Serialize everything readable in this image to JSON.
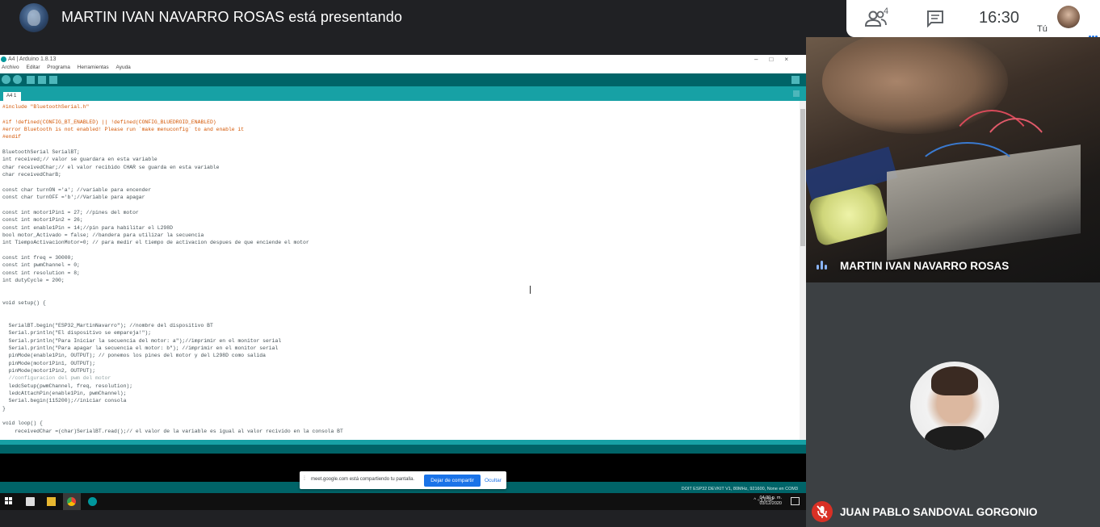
{
  "meet": {
    "presenting_text": "MARTIN IVAN NAVARRO ROSAS está presentando",
    "people_count": "4",
    "clock": "16:30",
    "self_label": "Tú",
    "participants": [
      {
        "name": "MARTIN IVAN NAVARRO ROSAS",
        "audio": "speaking"
      },
      {
        "name": "JUAN PABLO SANDOVAL GORGONIO",
        "audio": "muted"
      }
    ],
    "share_notice": {
      "message": "meet.google.com está compartiendo tu pantalla.",
      "stop_label": "Dejar de compartir",
      "hide_label": "Ocultar"
    },
    "colors": {
      "accent": "#1a73e8",
      "muted": "#d93025",
      "background": "#202124",
      "arduino_teal": "#00979c"
    }
  },
  "arduino": {
    "window_title": "A4 | Arduino 1.8.13",
    "menu": [
      "Archivo",
      "Editar",
      "Programa",
      "Herramientas",
      "Ayuda"
    ],
    "tab": "A4 1",
    "board_info": "DOIT ESP32 DEVKIT V1, 80MHz, 921600, None en COM3",
    "code_lines": [
      "#include \"BluetoothSerial.h\"",
      "",
      "#if !defined(CONFIG_BT_ENABLED) || !defined(CONFIG_BLUEDROID_ENABLED)",
      "#error Bluetooth is not enabled! Please run `make menuconfig` to and enable it",
      "#endif",
      "",
      "BluetoothSerial SerialBT;",
      "int received;// valor se guardara en esta variable",
      "char receivedChar;// el valor recibido CHAR se guarda en esta variable",
      "char receivedCharB;",
      "",
      "const char turnON ='a'; //variable para encender",
      "const char turnOFF ='b';//Variable para apagar",
      "",
      "const int motor1Pin1 = 27; //pines del motor",
      "const int motor1Pin2 = 26;",
      "const int enable1Pin = 14;//pin para habilitar el L298D",
      "bool motor_Activado = false; //bandera para utilizar la secuencia",
      "int TiempoActivacionMotor=0; // para medir el tiempo de activacion despues de que enciende el motor",
      "",
      "const int freq = 30000;",
      "const int pwmChannel = 0;",
      "const int resolution = 8;",
      "int dutyCycle = 200;",
      "",
      "",
      "void setup() {",
      "",
      "",
      "  SerialBT.begin(\"ESP32_MartinNavarro\"); //nombre del dispositivo BT",
      "  Serial.println(\"El dispositivo se empareja!\");",
      "  Serial.println(\"Para Iniciar la secuencia del motor: a\");//imprimir en el monitor serial",
      "  Serial.println(\"Para apagar la secuencia el motor: b\"); //imprimir en el monitor serial",
      "  pinMode(enable1Pin, OUTPUT); // ponemos los pines del motor y del L298D como salida",
      "  pinMode(motor1Pin1, OUTPUT);",
      "  pinMode(motor1Pin2, OUTPUT);",
      "  //configuracion del pwm del motor",
      "  ledcSetup(pwmChannel, freq, resolution);",
      "  ledcAttachPin(enable1Pin, pwmChannel);",
      "  Serial.begin(115200);//iniciar consola",
      "}",
      "",
      "void loop() {",
      "    receivedChar =(char)SerialBT.read();// el valor de la variable es igual al valor recivido en la consola BT"
    ]
  },
  "taskbar": {
    "language": "ESP",
    "time": "04:30 p. m.",
    "date": "03/12/2020"
  }
}
